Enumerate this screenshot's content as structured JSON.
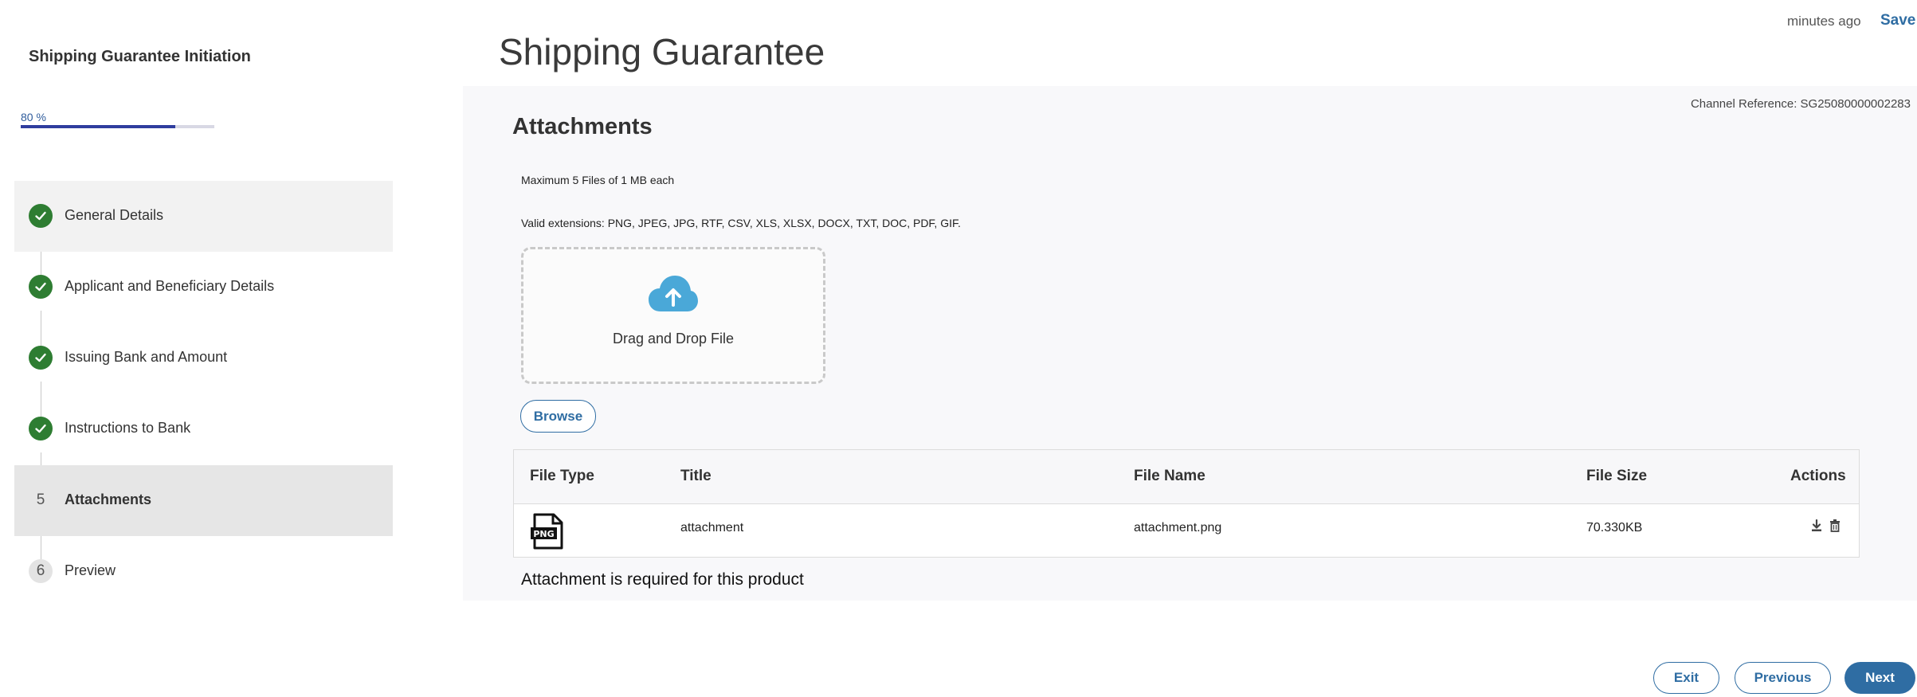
{
  "sidebar": {
    "title": "Shipping Guarantee Initiation",
    "progress": {
      "label": "80 %",
      "fraction": 0.8
    },
    "steps": [
      {
        "label": "General Details",
        "status": "done"
      },
      {
        "label": "Applicant and Beneficiary Details",
        "status": "done"
      },
      {
        "label": "Issuing Bank and Amount",
        "status": "done"
      },
      {
        "label": "Instructions to Bank",
        "status": "done"
      },
      {
        "number": "5",
        "label": "Attachments",
        "status": "active"
      },
      {
        "number": "6",
        "label": "Preview",
        "status": "pending"
      }
    ]
  },
  "header": {
    "title": "Shipping Guarantee",
    "saved_time": "minutes ago",
    "save_label": "Save"
  },
  "main": {
    "channel_reference": "Channel Reference: SG25080000002283",
    "section_title": "Attachments",
    "max_files_note": "Maximum 5 Files of 1 MB each",
    "extensions_note": "Valid extensions: PNG, JPEG, JPG, RTF, CSV, XLS, XLSX, DOCX, TXT, DOC, PDF, GIF.",
    "dropzone_text": "Drag and Drop File",
    "browse_label": "Browse",
    "table": {
      "headers": {
        "file_type": "File Type",
        "title": "Title",
        "file_name": "File Name",
        "file_size": "File Size",
        "actions": "Actions"
      },
      "rows": [
        {
          "file_type_icon": "png-file-icon",
          "file_type_text": "PNG",
          "title": "attachment",
          "file_name": "attachment.png",
          "file_size": "70.330KB"
        }
      ]
    },
    "error_message": "Attachment is required for this product"
  },
  "footer": {
    "exit_label": "Exit",
    "previous_label": "Previous",
    "next_label": "Next"
  },
  "colors": {
    "primary": "#2f6da3",
    "progress_fill": "#2f3d9e",
    "step_done": "#2e7d32",
    "upload_icon": "#4aa8d8",
    "panel_bg": "#f8f8fa"
  }
}
